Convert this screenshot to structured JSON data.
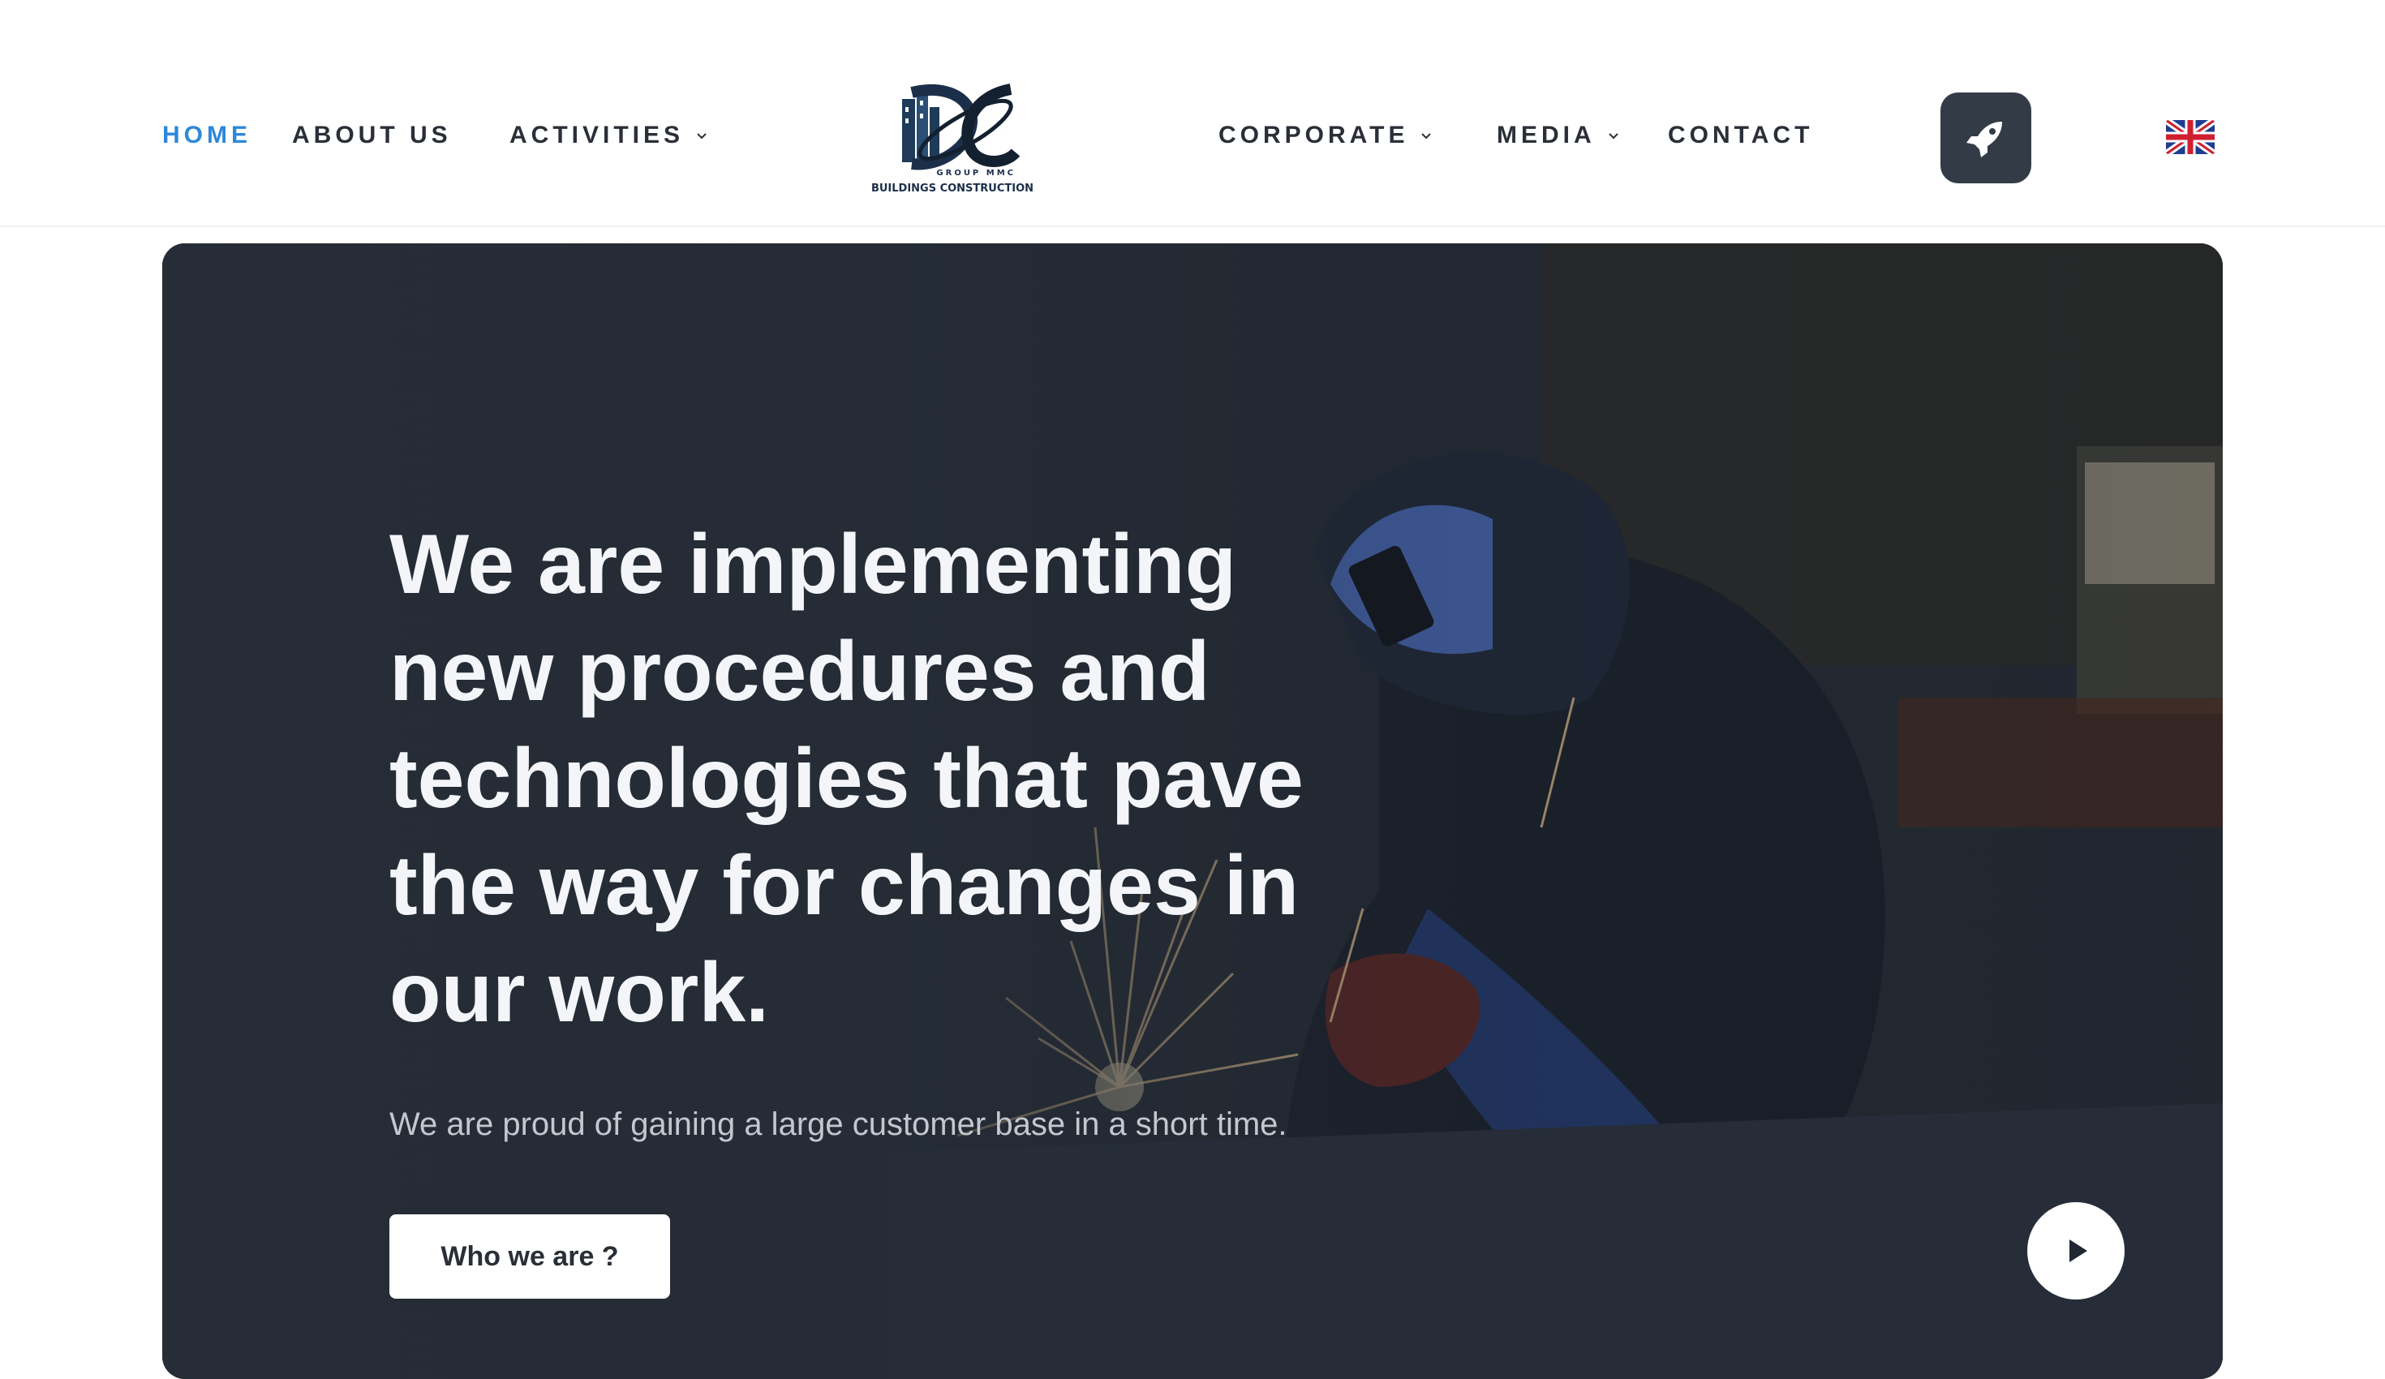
{
  "nav": {
    "home": "HOME",
    "about": "ABOUT US",
    "activities": "ACTIVITIES",
    "corporate": "CORPORATE",
    "media": "MEDIA",
    "contact": "CONTACT"
  },
  "logo": {
    "brand_text": "GROUP MMC",
    "tagline": "BUILDINGS CONSTRUCTION"
  },
  "icons": {
    "rocket": "rocket-icon",
    "flag": "uk-flag-icon",
    "play": "play-icon",
    "chevron": "chevron-down-icon"
  },
  "hero": {
    "headline": "We are implementing new procedures and technologies that pave the way for changes in our work.",
    "subline": "We are proud of gaining a large customer base in a short time.",
    "cta_label": "Who we are ?"
  },
  "colors": {
    "active_nav": "#2e88d8",
    "nav_text": "#2a2f37",
    "rocket_bg": "#333b46",
    "hero_bg": "#2b323c"
  }
}
